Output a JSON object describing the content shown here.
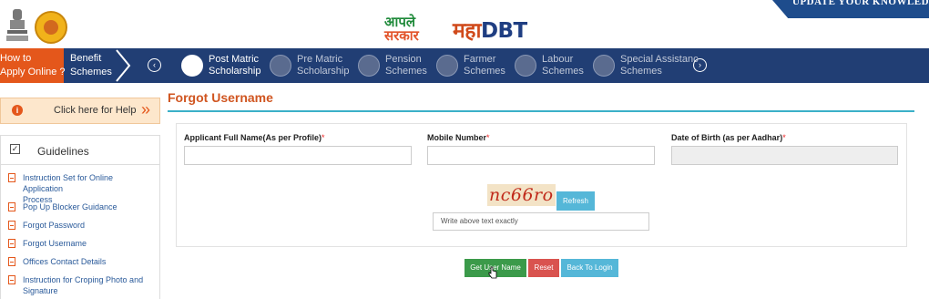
{
  "header": {
    "logo_top": "आपले",
    "logo_bottom": "सरकार",
    "brand_maha": "महा",
    "brand_dbt": "DBT",
    "ribbon": "UPDATE YOUR KNOWLEDGE"
  },
  "nav": {
    "how_to_line1": "How to",
    "how_to_line2": "Apply Online ?",
    "benefit_line1": "Benefit",
    "benefit_line2": "Schemes",
    "items": [
      {
        "line1": "Post Matric",
        "line2": "Scholarship"
      },
      {
        "line1": "Pre Matric",
        "line2": "Scholarship"
      },
      {
        "line1": "Pension",
        "line2": "Schemes"
      },
      {
        "line1": "Farmer",
        "line2": "Schemes"
      },
      {
        "line1": "Labour",
        "line2": "Schemes"
      },
      {
        "line1": "Special Assistanc",
        "line2": "Schemes"
      }
    ]
  },
  "sidebar": {
    "help": "Click here for Help",
    "guidelines": "Guidelines",
    "links": [
      {
        "line1": "Instruction Set for Online Application",
        "line2": "Process"
      },
      {
        "line1": "Pop Up Blocker Guidance",
        "line2": ""
      },
      {
        "line1": "Forgot Password",
        "line2": ""
      },
      {
        "line1": "Forgot Username",
        "line2": ""
      },
      {
        "line1": "Offices Contact Details",
        "line2": ""
      },
      {
        "line1": "Instruction for Croping Photo and",
        "line2": "Signature"
      }
    ]
  },
  "main": {
    "title": "Forgot Username",
    "fields": [
      {
        "label": "Applicant Full Name(As per Profile)",
        "required": "*"
      },
      {
        "label": "Mobile Number",
        "required": "*"
      },
      {
        "label": "Date of Birth (as per Aadhar)",
        "required": "*"
      }
    ],
    "captcha_text": "nc66ro",
    "refresh": "Refresh",
    "captcha_placeholder": "Write above text exactly",
    "buttons": {
      "get": "Get User Name",
      "reset": "Reset",
      "back": "Back To Login"
    }
  },
  "colors": {
    "nav": "#213e74",
    "accent": "#e4571b",
    "title": "#d05520",
    "line": "#3bb0c8"
  }
}
